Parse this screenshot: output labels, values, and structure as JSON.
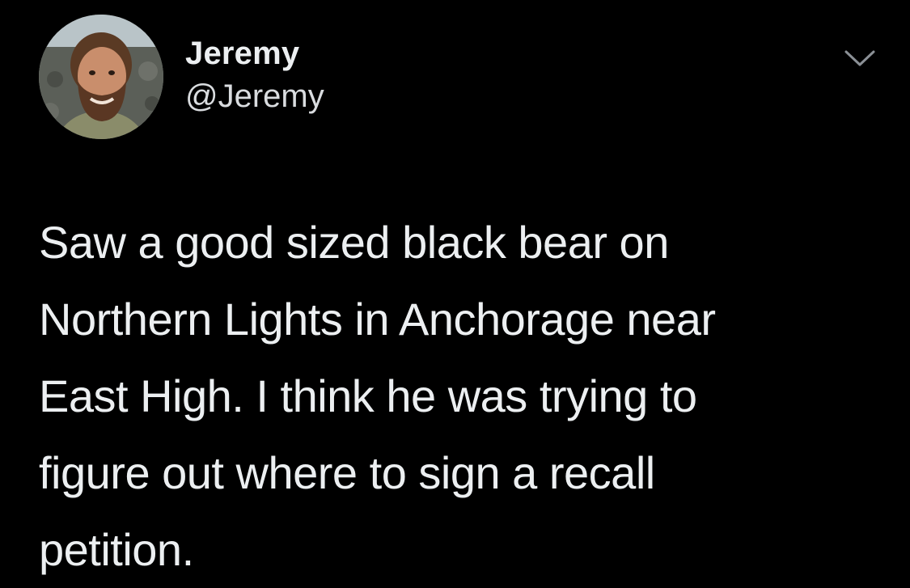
{
  "tweet": {
    "display_name": "Jeremy",
    "handle": "@Jeremy",
    "text": "Saw a good sized black bear on\nNorthern Lights in Anchorage near\nEast High. I think he was trying to\nfigure out where to sign a recall\npetition."
  },
  "icons": {
    "menu": "chevron-down-icon",
    "avatar": "avatar"
  },
  "colors": {
    "background": "#000000",
    "text": "#eceff1",
    "secondary_text": "#d9dcdf",
    "chevron": "#8b9096"
  }
}
